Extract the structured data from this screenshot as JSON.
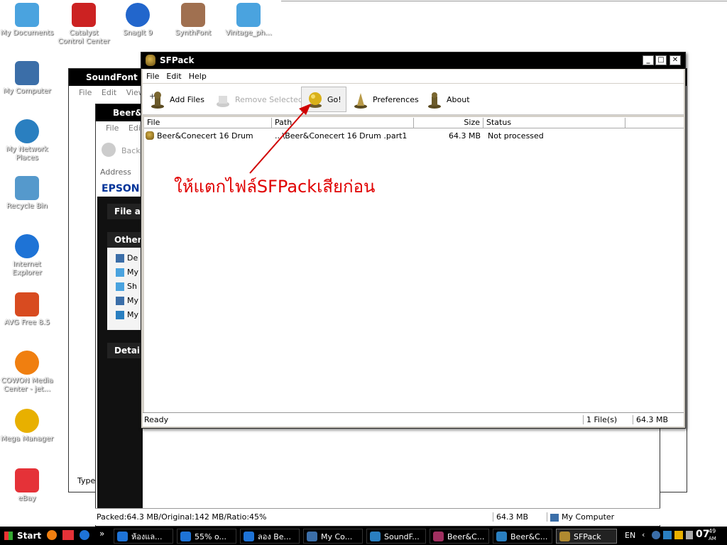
{
  "desktop": {
    "icons": [
      {
        "label": "My Documents",
        "color": "#4aa3df"
      },
      {
        "label": "Catalyst Control Center",
        "color": "#cc2222"
      },
      {
        "label": "SnagIt 9",
        "color": "#2266cc"
      },
      {
        "label": "SynthFont",
        "color": "#a07050"
      },
      {
        "label": "Vintage_ph...",
        "color": "#4aa3df"
      },
      {
        "label": "My Computer",
        "color": "#3b6ea8"
      },
      {
        "label": "My Network Places",
        "color": "#2a7fc0"
      },
      {
        "label": "Recycle Bin",
        "color": "#5599cc"
      },
      {
        "label": "Internet Explorer",
        "color": "#1e73d6"
      },
      {
        "label": "AVG Free 8.5",
        "color": "#d84b20"
      },
      {
        "label": "COWON Media Center - jet...",
        "color": "#f07f10"
      },
      {
        "label": "Mega Manager",
        "color": "#e8b000"
      },
      {
        "label": "eBay",
        "color": "#e53238"
      }
    ]
  },
  "background_windows": {
    "soundfont_title": "SoundFont",
    "soundfont_menu": "File  Edit  View",
    "beer_title": "Beer&C",
    "beer_menu": "File  Edit",
    "back_label": "Back",
    "address_label": "Address",
    "epson_label": "EPSON",
    "panel_file": "File an",
    "panel_other": "Other",
    "other_items": [
      "De",
      "My",
      "Sh",
      "My",
      "My"
    ],
    "panel_details": "Details",
    "type_label": "Type:"
  },
  "sfpack": {
    "title": "SFPack",
    "menu": [
      "File",
      "Edit",
      "Help"
    ],
    "toolbar": {
      "add_files": "Add Files",
      "remove_selected": "Remove Selected",
      "go": "Go!",
      "preferences": "Preferences",
      "about": "About"
    },
    "columns": [
      "File",
      "Path",
      "Size",
      "Status"
    ],
    "rows": [
      {
        "file": "Beer&Conecert 16 Drum",
        "path": "...\\Beer&Conecert 16 Drum .part1",
        "size": "64.3 MB",
        "status": "Not processed"
      }
    ],
    "status": {
      "left": "Ready",
      "count": "1 File(s)",
      "total": "64.3 MB"
    }
  },
  "annotation": "ให้แตกไฟล์SFPackเสียก่อน",
  "explorer_status": {
    "packed": "Packed:64.3 MB/Original:142 MB/Ratio:45%",
    "size": "64.3 MB",
    "location": "My Computer"
  },
  "taskbar": {
    "start": "Start",
    "tasks": [
      {
        "label": "ห้องแล...",
        "color": "#1e73d6"
      },
      {
        "label": "55% o...",
        "color": "#1e73d6"
      },
      {
        "label": "ลอง Be...",
        "color": "#1e73d6"
      },
      {
        "label": "My Co...",
        "color": "#3b6ea8"
      },
      {
        "label": "SoundF...",
        "color": "#2a7fc0"
      },
      {
        "label": "Beer&C...",
        "color": "#a03060"
      },
      {
        "label": "Beer&C...",
        "color": "#2a7fc0"
      },
      {
        "label": "SFPack",
        "color": "#b08a30"
      }
    ],
    "lang": "EN",
    "time": "07",
    "time_min": "49",
    "ampm": "AM"
  }
}
